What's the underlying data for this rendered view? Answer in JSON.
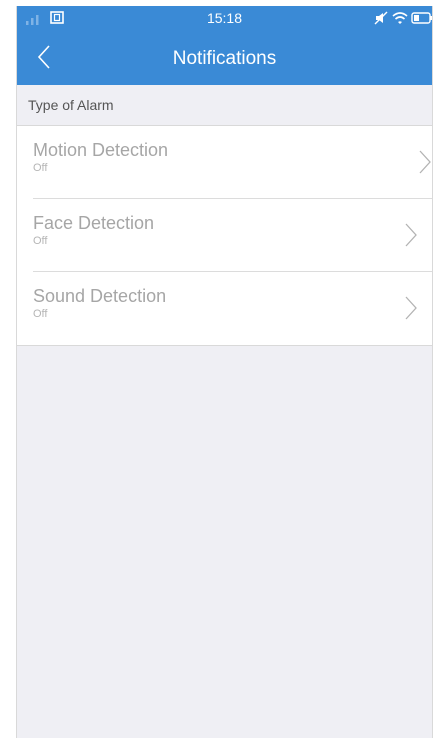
{
  "status_bar": {
    "time": "15:18",
    "signal_icon": "signal-icon",
    "sim_icon": "sim-card-icon",
    "mute_icon": "mute-icon",
    "wifi_icon": "wifi-icon",
    "battery_icon": "battery-icon"
  },
  "header": {
    "title": "Notifications",
    "back_icon": "chevron-left-icon",
    "color": "#3a8ad6"
  },
  "section": {
    "label": "Type of Alarm"
  },
  "alarms": [
    {
      "title": "Motion Detection",
      "status": "Off"
    },
    {
      "title": "Face Detection",
      "status": "Off"
    },
    {
      "title": "Sound Detection",
      "status": "Off"
    }
  ],
  "colors": {
    "background": "#efeff4",
    "item_text": "#a6a6a6"
  }
}
